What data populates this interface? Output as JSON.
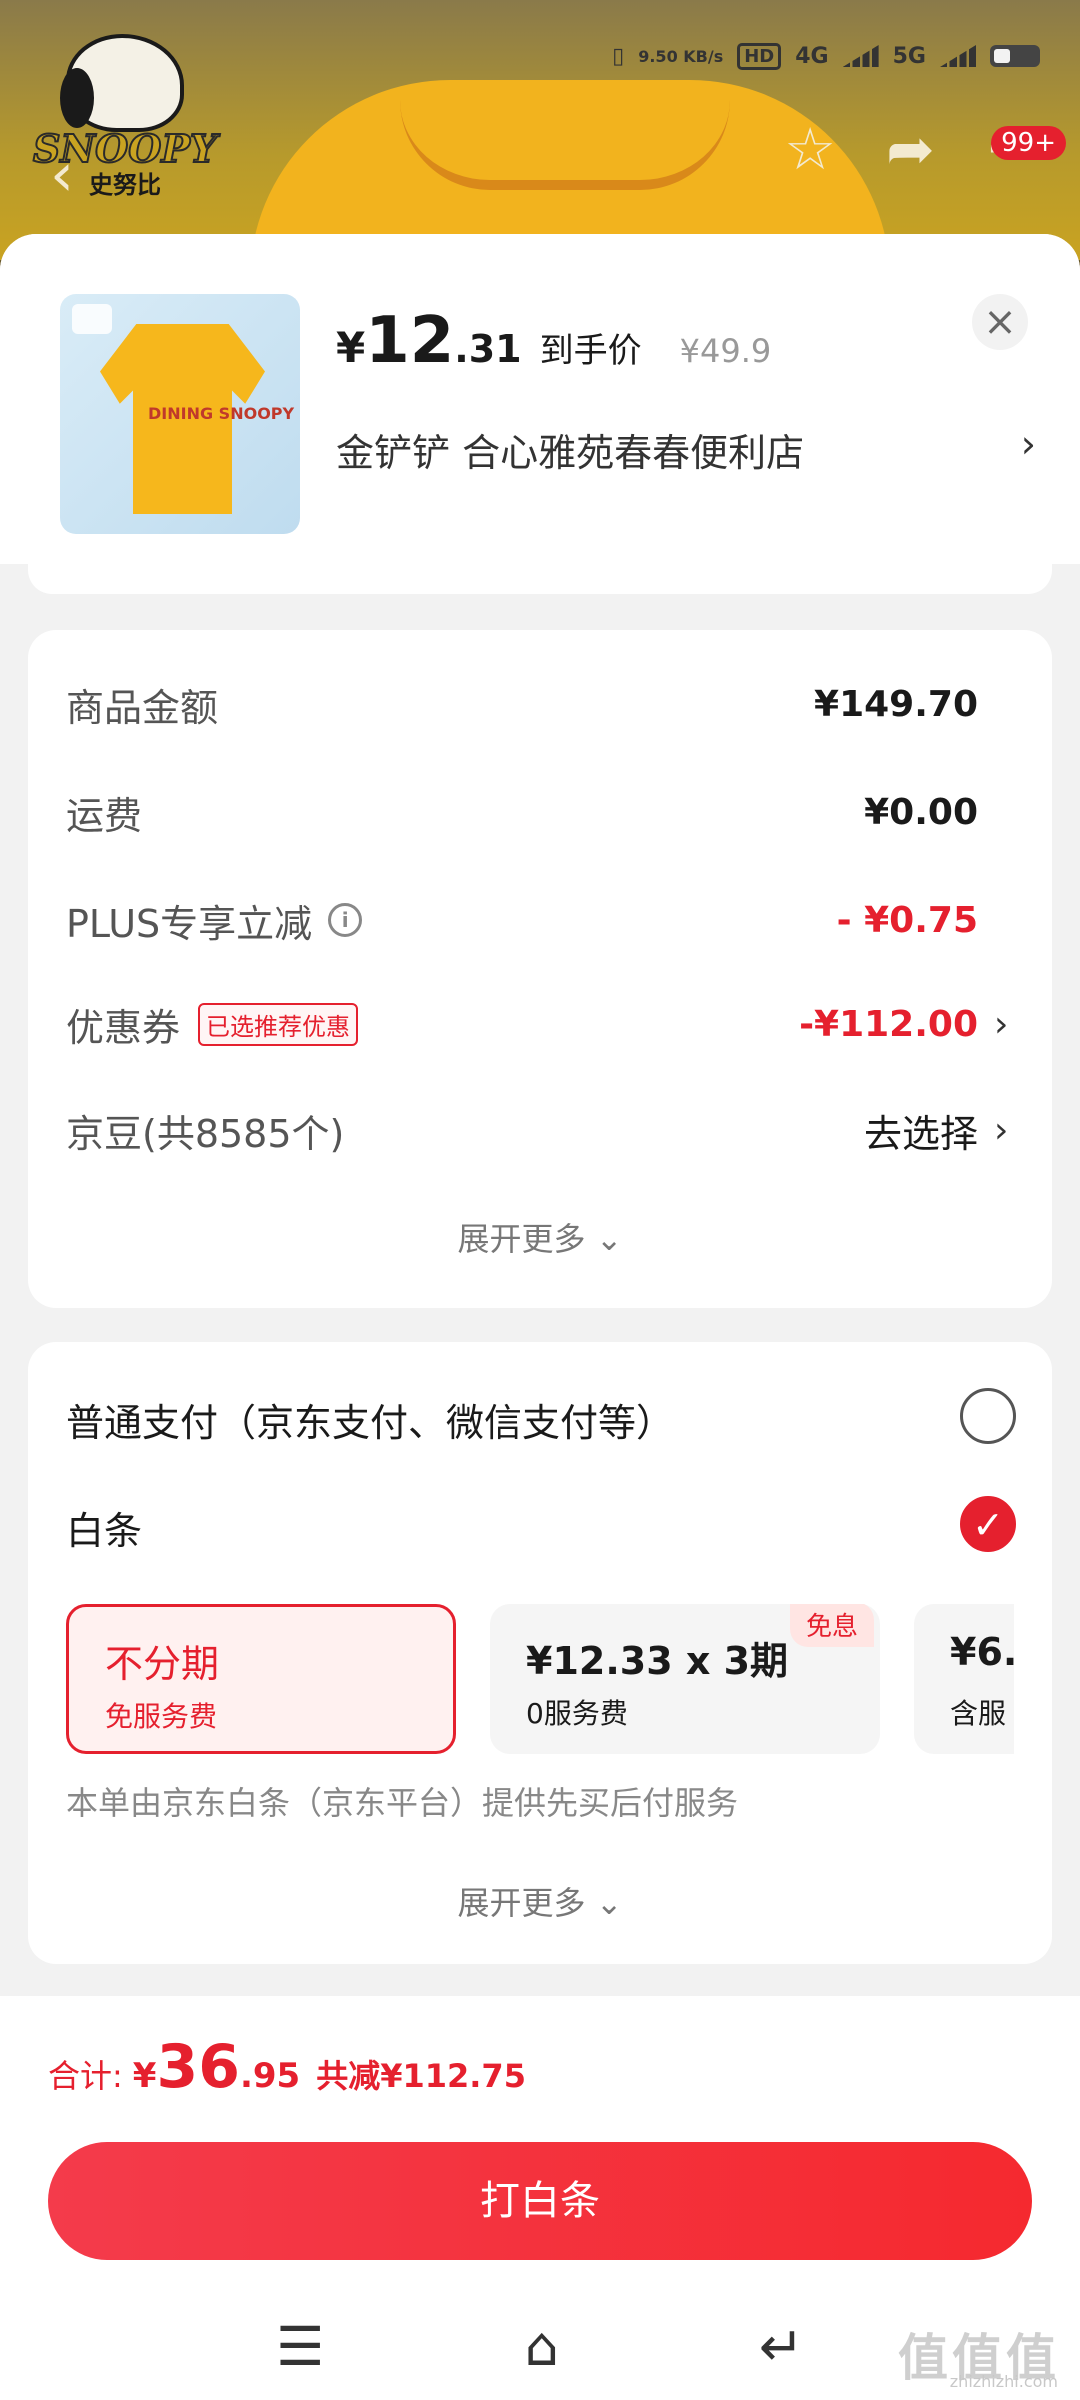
{
  "background": {
    "brand_logo_text": "SNOOPY",
    "brand_logo_cn": "史努比",
    "status": {
      "net_speed": "9.50 KB/s",
      "hd": "HD",
      "net1": "4G",
      "net2": "5G"
    },
    "cart_badge": "99+"
  },
  "header": {
    "price_currency": "¥",
    "price_int": "12",
    "price_dec": ".31",
    "price_tag": "到手价",
    "original_price": "¥49.9",
    "close_icon": "×",
    "store_name": "金铲铲  合心雅苑春春便利店",
    "thumb_text": "DINING SNOOPY"
  },
  "summary": {
    "rows": [
      {
        "label": "商品金额",
        "value": "¥149.70"
      },
      {
        "label": "运费",
        "value": "¥0.00"
      },
      {
        "label": "PLUS专享立减",
        "value": "- ¥0.75"
      },
      {
        "label": "优惠券",
        "badge": "已选推荐优惠",
        "value": "-¥112.00"
      },
      {
        "label": "京豆(共8585个)",
        "value": "去选择"
      }
    ],
    "expand_label": "展开更多"
  },
  "payment": {
    "options": [
      {
        "label": "普通支付（京东支付、微信支付等）",
        "checked": false
      },
      {
        "label": "白条",
        "checked": true
      }
    ],
    "plans": [
      {
        "title": "不分期",
        "sub": "免服务费",
        "selected": true
      },
      {
        "title": "¥12.33 x 3期",
        "sub": "0服务费",
        "badge": "免息"
      },
      {
        "title": "¥6.",
        "sub": "含服"
      }
    ],
    "note": "本单由京东白条（京东平台）提供先买后付服务",
    "expand_label": "展开更多"
  },
  "footer": {
    "total_label": "合计:",
    "total_currency": "¥",
    "total_int": "36",
    "total_dec": ".95",
    "discount": "共减¥112.75",
    "pay_button": "打白条"
  },
  "watermark": {
    "main": "值值值",
    "sub": "zhizhizhi.com"
  },
  "colors": {
    "accent": "#e5202e",
    "sheet_bg": "#f2f2f2"
  }
}
